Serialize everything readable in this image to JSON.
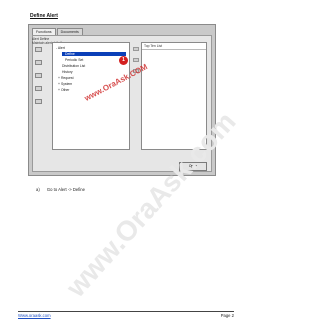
{
  "heading": "Define Alert",
  "window": {
    "tabs": [
      {
        "label": "Functions"
      },
      {
        "label": "Documents"
      }
    ],
    "labels": [
      "Alert Define",
      "Maintain alert definitions"
    ],
    "tree": {
      "items": [
        {
          "label": "Alert"
        },
        {
          "label": "Define"
        },
        {
          "label": "Periodic Set"
        },
        {
          "label": "Distribution List"
        },
        {
          "label": "History"
        },
        {
          "label": "Request"
        },
        {
          "label": "System"
        },
        {
          "label": "Other"
        }
      ]
    },
    "right_panel_header": "Top Ten List",
    "open_button": "Open",
    "marker_number": "1",
    "screenshot_watermark": "www.OraAsk.COM",
    "logo": "ORACLE"
  },
  "step": {
    "letter": "a)",
    "text": "Go to Alert -> Define"
  },
  "page_watermark": "www.OraAsk.com",
  "footer": {
    "link": "Www.oraask.com",
    "page": "Page 2"
  }
}
